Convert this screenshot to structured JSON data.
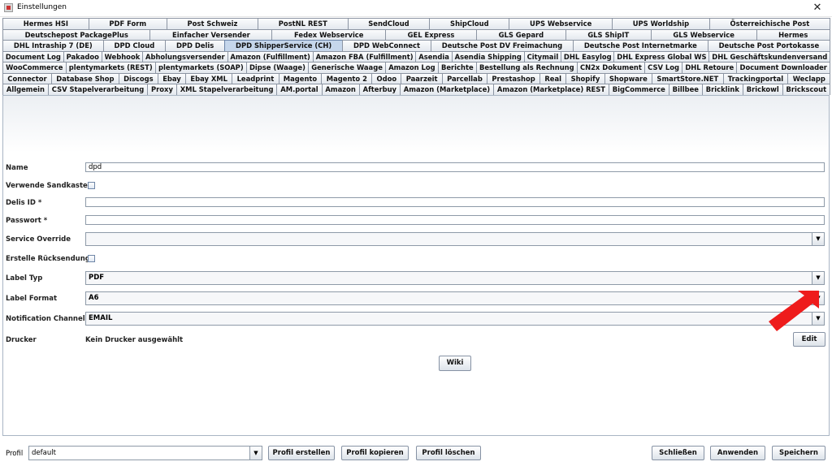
{
  "window": {
    "title": "Einstellungen",
    "close_glyph": "✕"
  },
  "tab_rows": [
    [
      "Hermes HSI",
      "PDF Form",
      "Post Schweiz",
      "PostNL REST",
      "SendCloud",
      "ShipCloud",
      "UPS Webservice",
      "UPS Worldship",
      "Österreichische Post"
    ],
    [
      "Deutschepost PackagePlus",
      "Einfacher Versender",
      "Fedex Webservice",
      "GEL Express",
      "GLS Gepard",
      "GLS ShipIT",
      "GLS Webservice",
      "Hermes"
    ],
    [
      "DHL Intraship 7 (DE)",
      "DPD Cloud",
      "DPD Delis",
      "DPD ShipperService (CH)",
      "DPD WebConnect",
      "Deutsche Post DV Freimachung",
      "Deutsche Post Internetmarke",
      "Deutsche Post Portokasse"
    ],
    [
      "Document Log",
      "Pakadoo",
      "Webhook",
      "Abholungsversender",
      "Amazon (Fulfillment)",
      "Amazon FBA (Fulfillment)",
      "Asendia",
      "Asendia Shipping",
      "Citymail",
      "DHL Easylog",
      "DHL Express Global WS",
      "DHL Geschäftskundenversand"
    ],
    [
      "WooCommerce",
      "plentymarkets (REST)",
      "plentymarkets (SOAP)",
      "Dipse (Waage)",
      "Generische Waage",
      "Amazon Log",
      "Berichte",
      "Bestellung als Rechnung",
      "CN2x Dokument",
      "CSV Log",
      "DHL Retoure",
      "Document Downloader"
    ],
    [
      "Connector",
      "Database Shop",
      "Discogs",
      "Ebay",
      "Ebay XML",
      "Leadprint",
      "Magento",
      "Magento 2",
      "Odoo",
      "Paarzeit",
      "Parcellab",
      "Prestashop",
      "Real",
      "Shopify",
      "Shopware",
      "SmartStore.NET",
      "Trackingportal",
      "Weclapp"
    ],
    [
      "Allgemein",
      "CSV Stapelverarbeitung",
      "Proxy",
      "XML Stapelverarbeitung",
      "AM.portal",
      "Amazon",
      "Afterbuy",
      "Amazon (Marketplace)",
      "Amazon (Marketplace) REST",
      "BigCommerce",
      "Billbee",
      "Bricklink",
      "Brickowl",
      "Brickscout"
    ]
  ],
  "selected_tab": "DPD ShipperService (CH)",
  "form": {
    "name": {
      "label": "Name",
      "value": "dpd"
    },
    "sandbox": {
      "label": "Verwende Sandkasten",
      "checked": false
    },
    "delis_id": {
      "label": "Delis ID *",
      "value": ""
    },
    "password": {
      "label": "Passwort *",
      "value": ""
    },
    "service_override": {
      "label": "Service Override",
      "value": ""
    },
    "create_return": {
      "label": "Erstelle Rücksendung",
      "checked": false
    },
    "label_type": {
      "label": "Label Typ",
      "value": "PDF"
    },
    "label_format": {
      "label": "Label Format",
      "value": "A6"
    },
    "notification_channel": {
      "label": "Notification Channel",
      "value": "EMAIL"
    },
    "printer": {
      "label": "Drucker",
      "value": "Kein Drucker ausgewählt",
      "edit_label": "Edit"
    },
    "wiki_label": "Wiki"
  },
  "footer": {
    "profile_label": "Profil",
    "profile_value": "default",
    "create_label": "Profil erstellen",
    "copy_label": "Profil kopieren",
    "delete_label": "Profil löschen",
    "close_label": "Schließen",
    "apply_label": "Anwenden",
    "save_label": "Speichern"
  },
  "icons": {
    "dropdown": "▼"
  },
  "colors": {
    "selected_tab": "#c5d6eb",
    "annotation_arrow": "#ee1c1c"
  }
}
